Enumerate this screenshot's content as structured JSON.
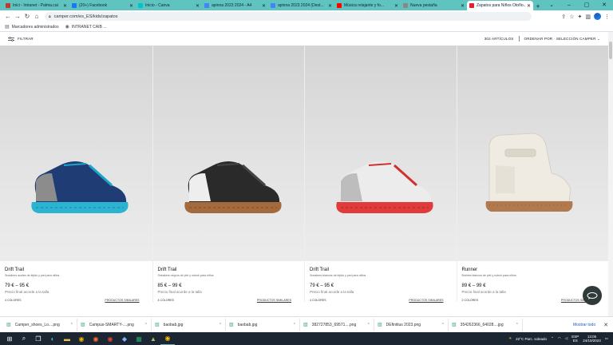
{
  "tabs": [
    {
      "title": "Inici - Intranet - Palma.cat",
      "color": "#c0392b"
    },
    {
      "title": "(20+) Facebook",
      "color": "#1877f2"
    },
    {
      "title": "Inicio - Canva",
      "color": "#00c4cc"
    },
    {
      "title": "apinna 2023 2024 - A4",
      "color": "#4285f4"
    },
    {
      "title": "apinna 2023 2024 (Dest...",
      "color": "#4285f4"
    },
    {
      "title": "Música relajante y fo...",
      "color": "#ff0000"
    },
    {
      "title": "Nueva pestaña",
      "color": "#888888"
    },
    {
      "title": "Zapatos para Niños Otoño...",
      "color": "#e0202e",
      "active": true
    }
  ],
  "toolbar": {
    "url": "camper.com/es_ES/kids/zapatos",
    "avatar_letter": "P"
  },
  "bookmarks": [
    {
      "label": "Marcadores administrados",
      "icon": "folder-icon"
    },
    {
      "label": "INTRANET CAIB ...",
      "icon": "globe-icon"
    }
  ],
  "filterbar": {
    "filter_label": "FILTRAR",
    "count_label": "302 ARTÍCULOS",
    "sort_label": "ORDENAR POR",
    "sort_value": "SELECCIÓN CAMPER"
  },
  "products": [
    {
      "name": "Drift Trail",
      "desc": "Sneakers azules de tejido y piel para niños",
      "price": "79 € – 95 €",
      "note": "Precio final acorde a la talla",
      "colors": "4 COLORES",
      "similar": "PRODUCTOS SIMILARES",
      "shoe": {
        "upper": "#1f3c75",
        "accent": "#1aa6c8",
        "sole": "#2bb3d1",
        "heel": "#8c8c8c"
      }
    },
    {
      "name": "Drift Trail",
      "desc": "Sneakers negros de piel y nobuk para niños",
      "price": "85 € – 99 €",
      "note": "Precio final acorde a la talla",
      "colors": "4 COLORES",
      "similar": "PRODUCTOS SIMILARES",
      "shoe": {
        "upper": "#2a2a2a",
        "accent": "#444444",
        "sole": "#a46a3b",
        "heel": "#eeeeee"
      }
    },
    {
      "name": "Drift Trail",
      "desc": "Sneakers blancos de tejido y piel para niños",
      "price": "79 € – 95 €",
      "note": "Precio final acorde a la talla",
      "colors": "4 COLORES",
      "similar": "PRODUCTOS SIMILARES",
      "shoe": {
        "upper": "#ececec",
        "accent": "#d03030",
        "sole": "#e03a3a",
        "heel": "#bdbdbd"
      }
    },
    {
      "name": "Runner",
      "desc": "Botines blancos de piel y nobuk para niños",
      "price": "89 € – 99 €",
      "note": "Precio final acorde a la talla",
      "colors": "2 COLORES",
      "similar": "PRODUCTOS SIMILARES",
      "shoe": {
        "upper": "#efebe3",
        "accent": "#dcd6ca",
        "sole": "#b07a4e",
        "heel": "#e6e1d6"
      }
    }
  ],
  "downloads": [
    "Camper_shoes_Lo....png",
    "Campus-SMARTY-....png",
    "baobab.jpg",
    "baobab.jpg",
    "382727853_69571....png",
    "DEfinitius 2023.png",
    "354262366_64028....jpg"
  ],
  "downloads_show_all": "Mostrar todo",
  "tray": {
    "weather": "22°C  Parc. soleado",
    "lang_top": "ESP",
    "lang_bottom": "ES",
    "time": "13:05",
    "date": "24/10/2023"
  }
}
